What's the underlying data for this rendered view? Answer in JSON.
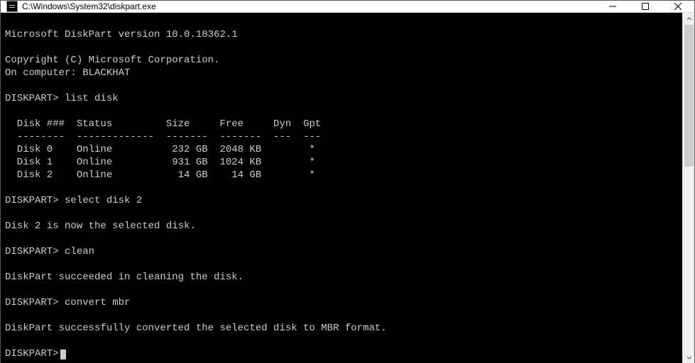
{
  "titlebar": {
    "title": "C:\\Windows\\System32\\diskpart.exe"
  },
  "terminal": {
    "blank": "",
    "version_line": "Microsoft DiskPart version 10.0.18362.1",
    "copyright_line": "Copyright (C) Microsoft Corporation.",
    "computer_line": "On computer: BLACKHAT",
    "prompt": "DISKPART>",
    "cmd_list_disk": " list disk",
    "header_line": "  Disk ###  Status         Size     Free     Dyn  Gpt",
    "divider_line": "  --------  -------------  -------  -------  ---  ---",
    "rows": [
      "  Disk 0    Online          232 GB  2048 KB        *",
      "  Disk 1    Online          931 GB  1024 KB        *",
      "  Disk 2    Online           14 GB    14 GB        *"
    ],
    "cmd_select": " select disk 2",
    "msg_selected": "Disk 2 is now the selected disk.",
    "cmd_clean": " clean",
    "msg_clean": "DiskPart succeeded in cleaning the disk.",
    "cmd_convert": " convert mbr",
    "msg_convert": "DiskPart successfully converted the selected disk to MBR format."
  },
  "chart_data": {
    "type": "table",
    "title": "list disk",
    "columns": [
      "Disk ###",
      "Status",
      "Size",
      "Free",
      "Dyn",
      "Gpt"
    ],
    "rows": [
      {
        "Disk ###": "Disk 0",
        "Status": "Online",
        "Size": "232 GB",
        "Free": "2048 KB",
        "Dyn": "",
        "Gpt": "*"
      },
      {
        "Disk ###": "Disk 1",
        "Status": "Online",
        "Size": "931 GB",
        "Free": "1024 KB",
        "Dyn": "",
        "Gpt": "*"
      },
      {
        "Disk ###": "Disk 2",
        "Status": "Online",
        "Size": "14 GB",
        "Free": "14 GB",
        "Dyn": "",
        "Gpt": "*"
      }
    ]
  }
}
